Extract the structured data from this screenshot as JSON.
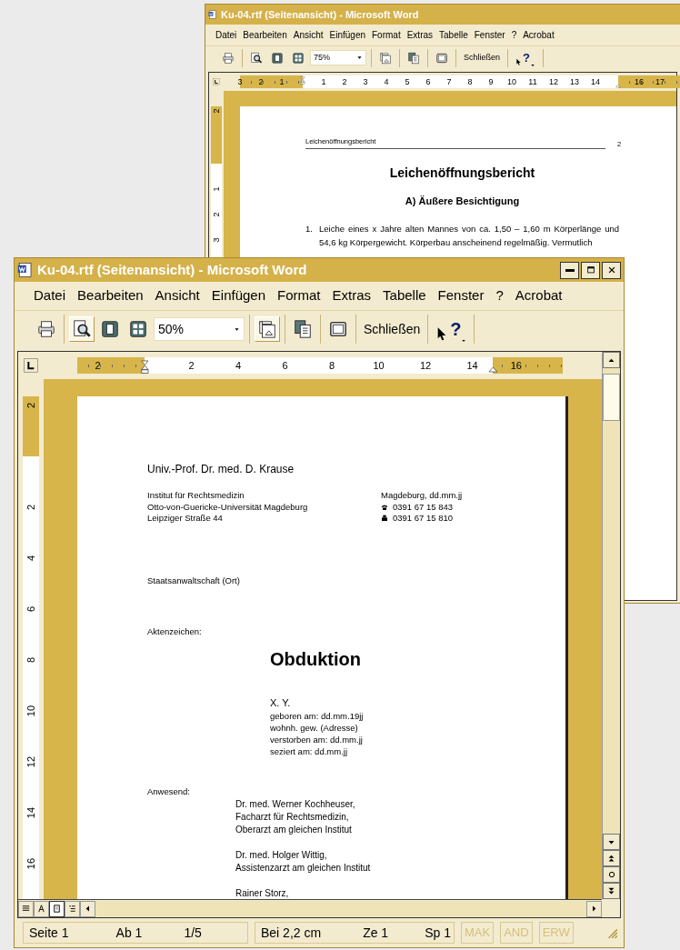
{
  "windows": [
    {
      "title": "Ku-04.rtf (Seitenansicht) - Microsoft Word",
      "menu": [
        "Datei",
        "Bearbeiten",
        "Ansicht",
        "Einfügen",
        "Format",
        "Extras",
        "Tabelle",
        "Fenster",
        "?",
        "Acrobat"
      ],
      "toolbar": [
        [
          {
            "kind": "print",
            "pressed": false
          }
        ],
        [
          {
            "kind": "preview",
            "pressed": false
          },
          {
            "kind": "one-page",
            "pressed": false
          },
          {
            "kind": "multi-page",
            "pressed": false
          },
          {
            "kind": "zoom",
            "value": "75%"
          }
        ],
        [
          {
            "kind": "ruler",
            "pressed": false
          }
        ],
        [
          {
            "kind": "shrink",
            "pressed": false
          }
        ],
        [
          {
            "kind": "full-screen",
            "pressed": false
          }
        ],
        [
          {
            "kind": "text",
            "label": "Schließen"
          }
        ],
        [
          {
            "kind": "help",
            "label": "?"
          }
        ]
      ],
      "ruler": {
        "left_labels": [
          "3",
          "2",
          "1"
        ],
        "body_labels": [
          "1",
          "2",
          "3",
          "4",
          "5",
          "6",
          "7",
          "8",
          "9",
          "10",
          "11",
          "12",
          "13",
          "14"
        ],
        "right_labels": [
          "16",
          "17"
        ]
      },
      "vertical_ruler": {
        "top_labels": [
          "2"
        ],
        "body_labels": [
          "1",
          "2",
          "3"
        ]
      },
      "document": {
        "kind": "report",
        "header": "Leichenöffnungsbericht",
        "page_number": "2",
        "title": "Leichenöffnungsbericht",
        "subtitle": "A) Äußere Besichtigung",
        "items": [
          {
            "number": "1.",
            "text": "Leiche eines x Jahre alten Mannes von ca. 1,50 – 1,60 m Körperlänge und 54,6 kg Körpergewicht. Körperbau anscheinend regelmäßig. Vermutlich"
          }
        ]
      }
    },
    {
      "title": "Ku-04.rtf (Seitenansicht) - Microsoft Word",
      "menu": [
        "Datei",
        "Bearbeiten",
        "Ansicht",
        "Einfügen",
        "Format",
        "Extras",
        "Tabelle",
        "Fenster",
        "?",
        "Acrobat"
      ],
      "toolbar": [
        [
          {
            "kind": "print",
            "pressed": false
          }
        ],
        [
          {
            "kind": "preview",
            "pressed": true
          },
          {
            "kind": "one-page",
            "pressed": false
          },
          {
            "kind": "multi-page",
            "pressed": false
          },
          {
            "kind": "zoom",
            "value": "50%"
          }
        ],
        [
          {
            "kind": "ruler",
            "pressed": true
          }
        ],
        [
          {
            "kind": "shrink",
            "pressed": false
          }
        ],
        [
          {
            "kind": "full-screen",
            "pressed": false
          }
        ],
        [
          {
            "kind": "text",
            "label": "Schließen"
          }
        ],
        [
          {
            "kind": "help",
            "label": "?"
          }
        ]
      ],
      "ruler": {
        "left_labels": [
          "2"
        ],
        "body_labels": [
          "2",
          "4",
          "6",
          "8",
          "10",
          "12",
          "14"
        ],
        "right_labels": [
          "16"
        ]
      },
      "vertical_ruler": {
        "top_labels": [
          "2"
        ],
        "body_labels": [
          "2",
          "4",
          "6",
          "8",
          "10",
          "12",
          "14",
          "16"
        ]
      },
      "document": {
        "kind": "letter",
        "sender": "Univ.-Prof. Dr. med. D. Krause",
        "address_lines": [
          "Institut für Rechtsmedizin",
          "Otto-von-Guericke-Universität Magdeburg",
          "Leipziger Straße 44"
        ],
        "date": "Magdeburg, dd.mm.jj",
        "contacts": [
          {
            "kind": "phone",
            "number": "0391 67 15 843"
          },
          {
            "kind": "fax",
            "number": "0391 67 15 810"
          }
        ],
        "recipient": "Staatsanwaltschaft (Ort)",
        "file_label": "Aktenzeichen:",
        "title": "Obduktion",
        "deceased_lines": [
          "X. Y.",
          "geboren am: dd.mm.19jj",
          "wohnh. gew. (Adresse)",
          "verstorben am: dd.mm.jj",
          "seziert am: dd.mm.jj"
        ],
        "present_label": "Anwesend:",
        "present_groups": [
          [
            "Dr. med. Werner Kochheuser,",
            "Facharzt für Rechtsmedizin,",
            "Oberarzt am gleichen Institut"
          ],
          [
            "Dr. med. Holger Wittig,",
            "Assistenzarzt am gleichen Institut"
          ],
          [
            "Rainer Storz,"
          ]
        ]
      },
      "view_buttons": [
        {
          "kind": "normal",
          "selected": false
        },
        {
          "kind": "web",
          "selected": false
        },
        {
          "kind": "print",
          "selected": true
        },
        {
          "kind": "outline",
          "selected": false
        }
      ],
      "status_bar": {
        "panels": [
          [
            "Seite 1",
            "Ab 1",
            "1/5"
          ],
          [
            "Bei 2,2 cm",
            "Ze 1",
            "Sp 1"
          ]
        ],
        "indicators": [
          {
            "label": "MAK",
            "disabled": true
          },
          {
            "label": "AND",
            "disabled": true
          },
          {
            "label": "ERW",
            "disabled": true
          }
        ]
      }
    }
  ]
}
